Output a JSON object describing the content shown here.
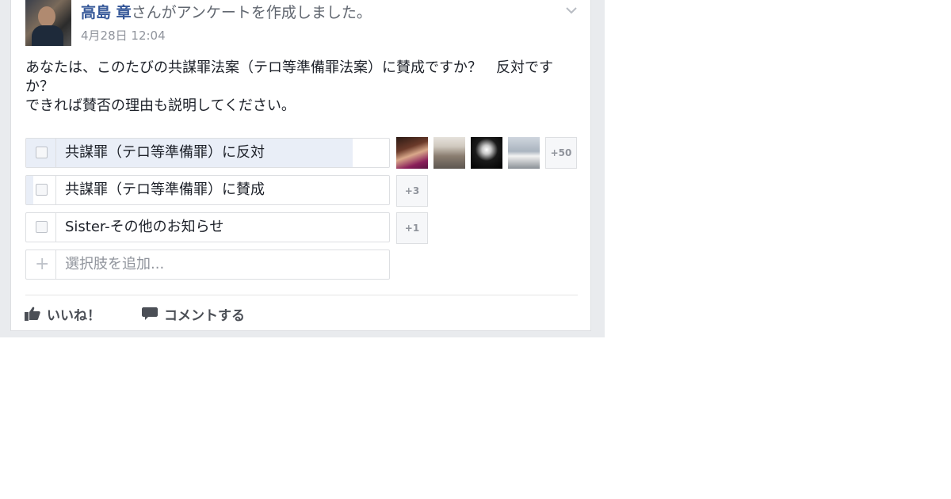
{
  "post": {
    "author": "高島 章",
    "action_text": "さんがアンケートを作成しました。",
    "timestamp": "4月28日 12:04",
    "question_line1": "あなたは、このたびの共謀罪法案（テロ等準備罪法案）に賛成ですか？　反対ですか？",
    "question_line2": "できれば賛否の理由も説明してください。"
  },
  "poll": {
    "options": [
      {
        "label": "共謀罪（テロ等準備罪）に反対",
        "vote_share": 0.9,
        "more_voters": "+50"
      },
      {
        "label": "共謀罪（テロ等準備罪）に賛成",
        "vote_share": 0.02,
        "more_voters": "+3"
      },
      {
        "label": "Sister-その他のお知らせ",
        "vote_share": 0.0,
        "more_voters": "+1"
      }
    ],
    "add_option_placeholder": "選択肢を追加...",
    "add_icon": "plus-icon"
  },
  "actions": {
    "like_label": "いいね！",
    "like_icon": "thumbs-up-icon",
    "comment_label": "コメントする",
    "comment_icon": "speech-bubble-icon"
  },
  "colors": {
    "author_link": "#365899",
    "vote_fill": "#e9eef7",
    "border": "#dddfe2"
  }
}
